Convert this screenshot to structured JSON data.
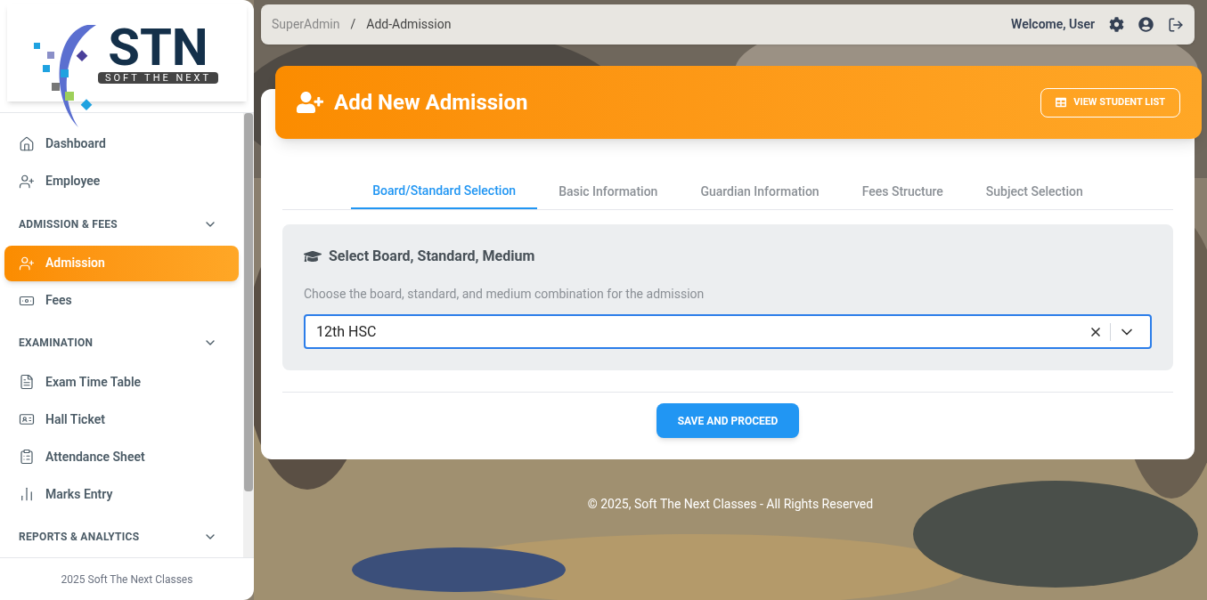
{
  "logo": {
    "letters": "STN",
    "tagline": "SOFT THE NEXT"
  },
  "sidebar": {
    "items": [
      {
        "kind": "item",
        "label": "Dashboard",
        "selected": false
      },
      {
        "kind": "item",
        "label": "Employee",
        "selected": false
      },
      {
        "kind": "section",
        "label": "ADMISSION & FEES",
        "expanded": true
      },
      {
        "kind": "item",
        "label": "Admission",
        "selected": true
      },
      {
        "kind": "item",
        "label": "Fees",
        "selected": false
      },
      {
        "kind": "section",
        "label": "EXAMINATION",
        "expanded": true
      },
      {
        "kind": "item",
        "label": "Exam Time Table",
        "selected": false
      },
      {
        "kind": "item",
        "label": "Hall Ticket",
        "selected": false
      },
      {
        "kind": "item",
        "label": "Attendance Sheet",
        "selected": false
      },
      {
        "kind": "item",
        "label": "Marks Entry",
        "selected": false
      },
      {
        "kind": "section",
        "label": "REPORTS & ANALYTICS",
        "expanded": true
      }
    ],
    "footer": "2025 Soft The Next Classes"
  },
  "breadcrumb": [
    "SuperAdmin",
    "Add-Admission"
  ],
  "breadcrumb_separator": "/",
  "topbar": {
    "welcome": "Welcome, User"
  },
  "header": {
    "title": "Add New Admission",
    "button": "VIEW STUDENT LIST"
  },
  "tabs": [
    {
      "label": "Board/Standard Selection",
      "selected": true
    },
    {
      "label": "Basic Information",
      "selected": false
    },
    {
      "label": "Guardian Information",
      "selected": false
    },
    {
      "label": "Fees Structure",
      "selected": false
    },
    {
      "label": "Subject Selection",
      "selected": false
    }
  ],
  "section": {
    "title": "Select Board, Standard, Medium",
    "description": "Choose the board, standard, and medium combination for the admission",
    "value": "12th HSC"
  },
  "submit": "SAVE AND PROCEED",
  "footer": "© 2025, Soft The Next Classes - All Rights Reserved"
}
